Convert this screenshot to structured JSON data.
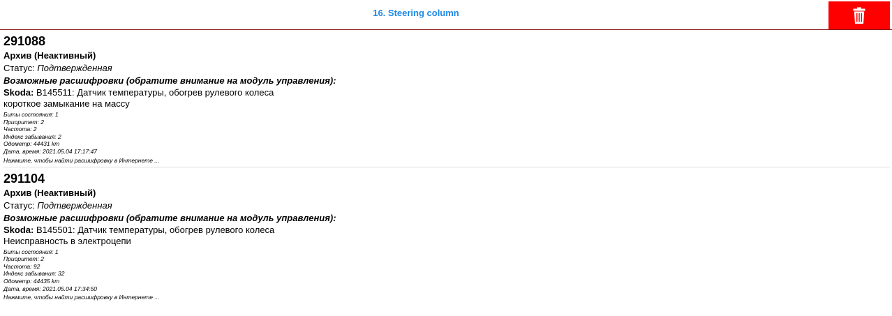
{
  "header": {
    "title": "16. Steering column",
    "delete_icon": "trash-icon",
    "delete_color": "#ff0000",
    "title_color": "#1e88e5"
  },
  "entries": [
    {
      "code": "291088",
      "archive": "Архив (Неактивный)",
      "status_label": "Статус: ",
      "status_value": "Подтвержденная",
      "hint": "Возможные расшифровки (обратите внимание на модуль управления):",
      "brand": "Skoda:",
      "desc_line1": " B145511: Датчик температуры, обогрев рулевого колеса",
      "desc_line2": "короткое замыкание на массу",
      "status_bits": "Биты состояния: 1",
      "priority": "Приоритет: 2",
      "frequency": "Частота: 2",
      "forget_index": "Индекс забывания: 2",
      "odometer": "Одометр: 44431 km",
      "datetime": "Дата, время: 2021.05.04 17:17:47",
      "search_link": "Нажмите, чтобы найти расшифровку в Интернете ..."
    },
    {
      "code": "291104",
      "archive": "Архив (Неактивный)",
      "status_label": "Статус: ",
      "status_value": "Подтвержденная",
      "hint": "Возможные расшифровки (обратите внимание на модуль управления):",
      "brand": "Skoda:",
      "desc_line1": " B145501: Датчик температуры, обогрев рулевого колеса",
      "desc_line2": "Неисправность в электроцепи",
      "status_bits": "Биты состояния: 1",
      "priority": "Приоритет: 2",
      "frequency": "Частота: 92",
      "forget_index": "Индекс забывания: 32",
      "odometer": "Одометр: 44435 km",
      "datetime": "Дата, время: 2021.05.04 17:34:50",
      "search_link": "Нажмите, чтобы найти расшифровку в Интернете ..."
    }
  ]
}
